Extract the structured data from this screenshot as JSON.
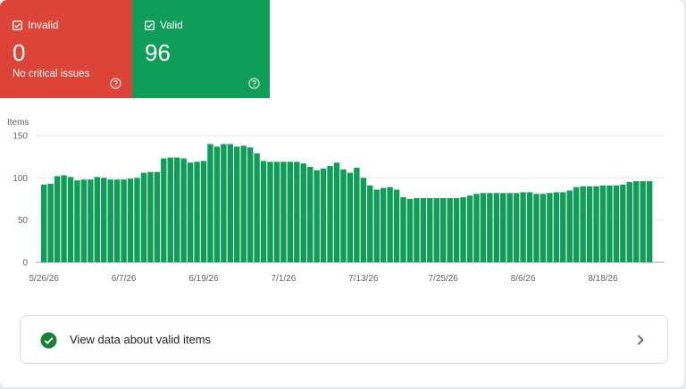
{
  "tiles": {
    "invalid": {
      "label": "Invalid",
      "count": "0",
      "subtitle": "No critical issues",
      "color": "#db4437",
      "icon": "checkbox-checked-icon",
      "help_icon": "help-circle-icon"
    },
    "valid": {
      "label": "Valid",
      "count": "96",
      "color": "#0f9d58",
      "icon": "checkbox-checked-icon",
      "help_icon": "help-circle-icon"
    }
  },
  "link": {
    "label": "View data about valid items",
    "icon": "check-circle-icon",
    "chevron_icon": "chevron-right-icon",
    "check_color": "#188038"
  },
  "chart_data": {
    "type": "bar",
    "ylabel": "Items",
    "ylim": [
      0,
      150
    ],
    "yticks": [
      0,
      50,
      100,
      150
    ],
    "grid": true,
    "bar_color": "#0f9d58",
    "xtick_labels": [
      {
        "label": "5/26/26",
        "index": 0
      },
      {
        "label": "6/7/26",
        "index": 12
      },
      {
        "label": "6/19/26",
        "index": 24
      },
      {
        "label": "7/1/26",
        "index": 36
      },
      {
        "label": "7/13/26",
        "index": 48
      },
      {
        "label": "7/25/26",
        "index": 60
      },
      {
        "label": "8/6/26",
        "index": 72
      },
      {
        "label": "8/18/26",
        "index": 84
      }
    ],
    "values": [
      92,
      93,
      102,
      103,
      101,
      97,
      98,
      98,
      101,
      100,
      98,
      98,
      98,
      99,
      100,
      106,
      107,
      107,
      123,
      124,
      124,
      123,
      118,
      119,
      120,
      140,
      137,
      140,
      140,
      137,
      138,
      136,
      129,
      120,
      119,
      119,
      119,
      119,
      119,
      117,
      113,
      109,
      111,
      114,
      118,
      110,
      106,
      112,
      100,
      91,
      86,
      88,
      89,
      86,
      77,
      75,
      76,
      76,
      76,
      76,
      76,
      76,
      76,
      77,
      79,
      81,
      82,
      82,
      82,
      82,
      82,
      82,
      83,
      83,
      81,
      81,
      82,
      83,
      83,
      85,
      89,
      90,
      90,
      90,
      91,
      91,
      91,
      92,
      95,
      96,
      96,
      96
    ]
  }
}
